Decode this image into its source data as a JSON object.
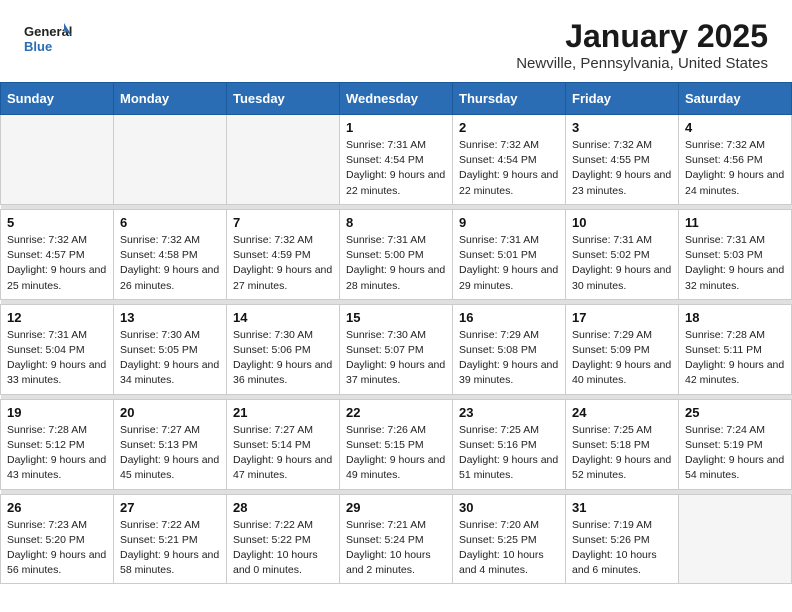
{
  "header": {
    "logo_line1": "General",
    "logo_line2": "Blue",
    "month": "January 2025",
    "location": "Newville, Pennsylvania, United States"
  },
  "weekdays": [
    "Sunday",
    "Monday",
    "Tuesday",
    "Wednesday",
    "Thursday",
    "Friday",
    "Saturday"
  ],
  "weeks": [
    [
      {
        "day": "",
        "sunrise": "",
        "sunset": "",
        "daylight": "",
        "empty": true
      },
      {
        "day": "",
        "sunrise": "",
        "sunset": "",
        "daylight": "",
        "empty": true
      },
      {
        "day": "",
        "sunrise": "",
        "sunset": "",
        "daylight": "",
        "empty": true
      },
      {
        "day": "1",
        "sunrise": "Sunrise: 7:31 AM",
        "sunset": "Sunset: 4:54 PM",
        "daylight": "Daylight: 9 hours and 22 minutes."
      },
      {
        "day": "2",
        "sunrise": "Sunrise: 7:32 AM",
        "sunset": "Sunset: 4:54 PM",
        "daylight": "Daylight: 9 hours and 22 minutes."
      },
      {
        "day": "3",
        "sunrise": "Sunrise: 7:32 AM",
        "sunset": "Sunset: 4:55 PM",
        "daylight": "Daylight: 9 hours and 23 minutes."
      },
      {
        "day": "4",
        "sunrise": "Sunrise: 7:32 AM",
        "sunset": "Sunset: 4:56 PM",
        "daylight": "Daylight: 9 hours and 24 minutes."
      }
    ],
    [
      {
        "day": "5",
        "sunrise": "Sunrise: 7:32 AM",
        "sunset": "Sunset: 4:57 PM",
        "daylight": "Daylight: 9 hours and 25 minutes."
      },
      {
        "day": "6",
        "sunrise": "Sunrise: 7:32 AM",
        "sunset": "Sunset: 4:58 PM",
        "daylight": "Daylight: 9 hours and 26 minutes."
      },
      {
        "day": "7",
        "sunrise": "Sunrise: 7:32 AM",
        "sunset": "Sunset: 4:59 PM",
        "daylight": "Daylight: 9 hours and 27 minutes."
      },
      {
        "day": "8",
        "sunrise": "Sunrise: 7:31 AM",
        "sunset": "Sunset: 5:00 PM",
        "daylight": "Daylight: 9 hours and 28 minutes."
      },
      {
        "day": "9",
        "sunrise": "Sunrise: 7:31 AM",
        "sunset": "Sunset: 5:01 PM",
        "daylight": "Daylight: 9 hours and 29 minutes."
      },
      {
        "day": "10",
        "sunrise": "Sunrise: 7:31 AM",
        "sunset": "Sunset: 5:02 PM",
        "daylight": "Daylight: 9 hours and 30 minutes."
      },
      {
        "day": "11",
        "sunrise": "Sunrise: 7:31 AM",
        "sunset": "Sunset: 5:03 PM",
        "daylight": "Daylight: 9 hours and 32 minutes."
      }
    ],
    [
      {
        "day": "12",
        "sunrise": "Sunrise: 7:31 AM",
        "sunset": "Sunset: 5:04 PM",
        "daylight": "Daylight: 9 hours and 33 minutes."
      },
      {
        "day": "13",
        "sunrise": "Sunrise: 7:30 AM",
        "sunset": "Sunset: 5:05 PM",
        "daylight": "Daylight: 9 hours and 34 minutes."
      },
      {
        "day": "14",
        "sunrise": "Sunrise: 7:30 AM",
        "sunset": "Sunset: 5:06 PM",
        "daylight": "Daylight: 9 hours and 36 minutes."
      },
      {
        "day": "15",
        "sunrise": "Sunrise: 7:30 AM",
        "sunset": "Sunset: 5:07 PM",
        "daylight": "Daylight: 9 hours and 37 minutes."
      },
      {
        "day": "16",
        "sunrise": "Sunrise: 7:29 AM",
        "sunset": "Sunset: 5:08 PM",
        "daylight": "Daylight: 9 hours and 39 minutes."
      },
      {
        "day": "17",
        "sunrise": "Sunrise: 7:29 AM",
        "sunset": "Sunset: 5:09 PM",
        "daylight": "Daylight: 9 hours and 40 minutes."
      },
      {
        "day": "18",
        "sunrise": "Sunrise: 7:28 AM",
        "sunset": "Sunset: 5:11 PM",
        "daylight": "Daylight: 9 hours and 42 minutes."
      }
    ],
    [
      {
        "day": "19",
        "sunrise": "Sunrise: 7:28 AM",
        "sunset": "Sunset: 5:12 PM",
        "daylight": "Daylight: 9 hours and 43 minutes."
      },
      {
        "day": "20",
        "sunrise": "Sunrise: 7:27 AM",
        "sunset": "Sunset: 5:13 PM",
        "daylight": "Daylight: 9 hours and 45 minutes."
      },
      {
        "day": "21",
        "sunrise": "Sunrise: 7:27 AM",
        "sunset": "Sunset: 5:14 PM",
        "daylight": "Daylight: 9 hours and 47 minutes."
      },
      {
        "day": "22",
        "sunrise": "Sunrise: 7:26 AM",
        "sunset": "Sunset: 5:15 PM",
        "daylight": "Daylight: 9 hours and 49 minutes."
      },
      {
        "day": "23",
        "sunrise": "Sunrise: 7:25 AM",
        "sunset": "Sunset: 5:16 PM",
        "daylight": "Daylight: 9 hours and 51 minutes."
      },
      {
        "day": "24",
        "sunrise": "Sunrise: 7:25 AM",
        "sunset": "Sunset: 5:18 PM",
        "daylight": "Daylight: 9 hours and 52 minutes."
      },
      {
        "day": "25",
        "sunrise": "Sunrise: 7:24 AM",
        "sunset": "Sunset: 5:19 PM",
        "daylight": "Daylight: 9 hours and 54 minutes."
      }
    ],
    [
      {
        "day": "26",
        "sunrise": "Sunrise: 7:23 AM",
        "sunset": "Sunset: 5:20 PM",
        "daylight": "Daylight: 9 hours and 56 minutes."
      },
      {
        "day": "27",
        "sunrise": "Sunrise: 7:22 AM",
        "sunset": "Sunset: 5:21 PM",
        "daylight": "Daylight: 9 hours and 58 minutes."
      },
      {
        "day": "28",
        "sunrise": "Sunrise: 7:22 AM",
        "sunset": "Sunset: 5:22 PM",
        "daylight": "Daylight: 10 hours and 0 minutes."
      },
      {
        "day": "29",
        "sunrise": "Sunrise: 7:21 AM",
        "sunset": "Sunset: 5:24 PM",
        "daylight": "Daylight: 10 hours and 2 minutes."
      },
      {
        "day": "30",
        "sunrise": "Sunrise: 7:20 AM",
        "sunset": "Sunset: 5:25 PM",
        "daylight": "Daylight: 10 hours and 4 minutes."
      },
      {
        "day": "31",
        "sunrise": "Sunrise: 7:19 AM",
        "sunset": "Sunset: 5:26 PM",
        "daylight": "Daylight: 10 hours and 6 minutes."
      },
      {
        "day": "",
        "sunrise": "",
        "sunset": "",
        "daylight": "",
        "empty": true
      }
    ]
  ]
}
